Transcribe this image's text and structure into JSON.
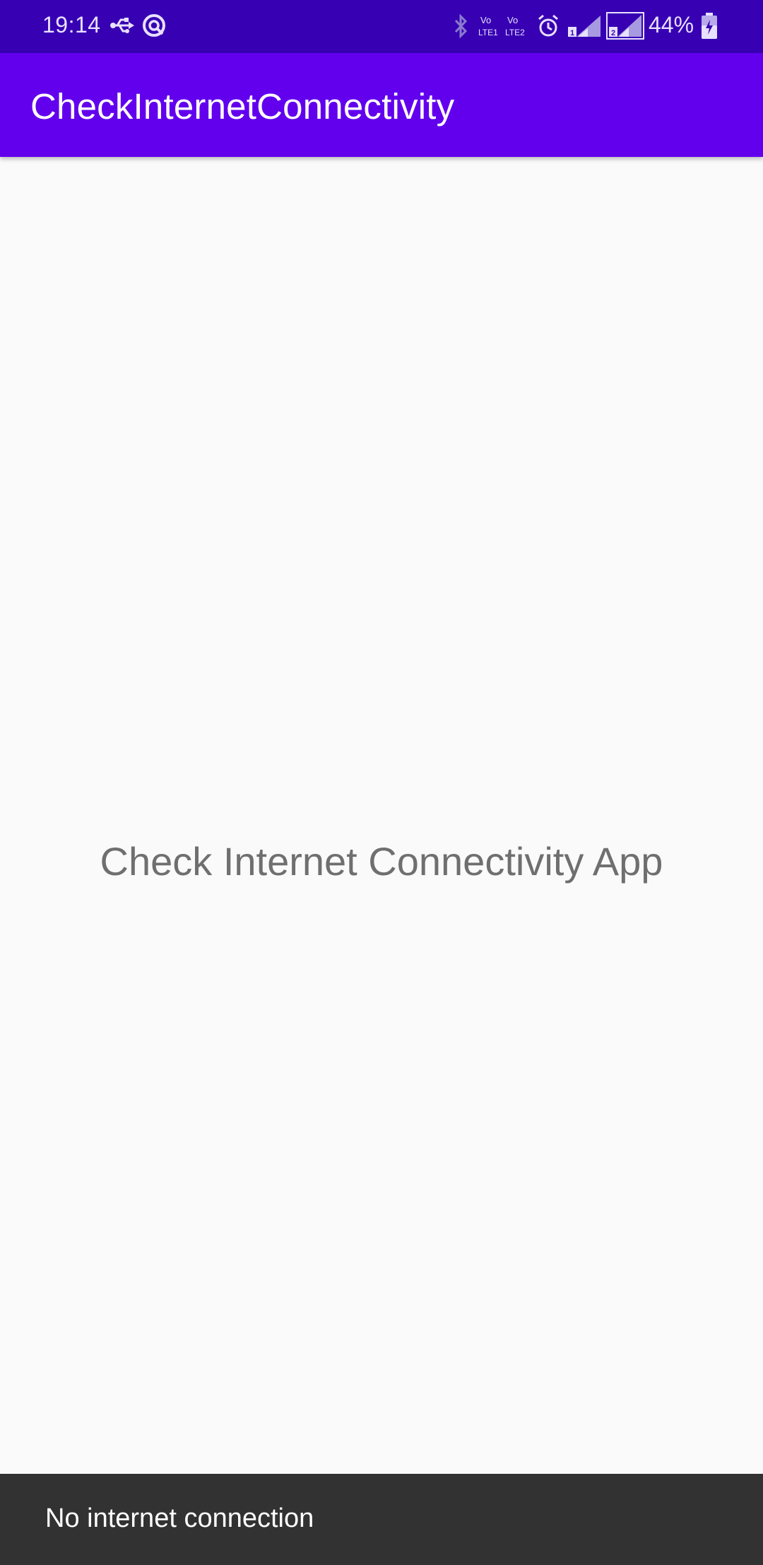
{
  "status_bar": {
    "time": "19:14",
    "battery_percent": "44%",
    "icons": [
      "usb-icon",
      "sync-icon",
      "bluetooth-icon",
      "volte1-icon",
      "volte2-icon",
      "alarm-icon",
      "signal-sim1-icon",
      "signal-sim2-icon",
      "battery-charging-icon"
    ],
    "volte1_label": "Vo\nLTE1",
    "volte2_label": "Vo\nLTE2",
    "sim1_label": "1",
    "sim2_label": "2"
  },
  "app_bar": {
    "title": "CheckInternetConnectivity"
  },
  "main": {
    "label": "Check Internet Connectivity App"
  },
  "snackbar": {
    "message": "No internet connection"
  },
  "colors": {
    "status_bar": "#3700b3",
    "app_bar": "#6200ee",
    "background": "#fafafa",
    "snackbar": "#323232"
  }
}
